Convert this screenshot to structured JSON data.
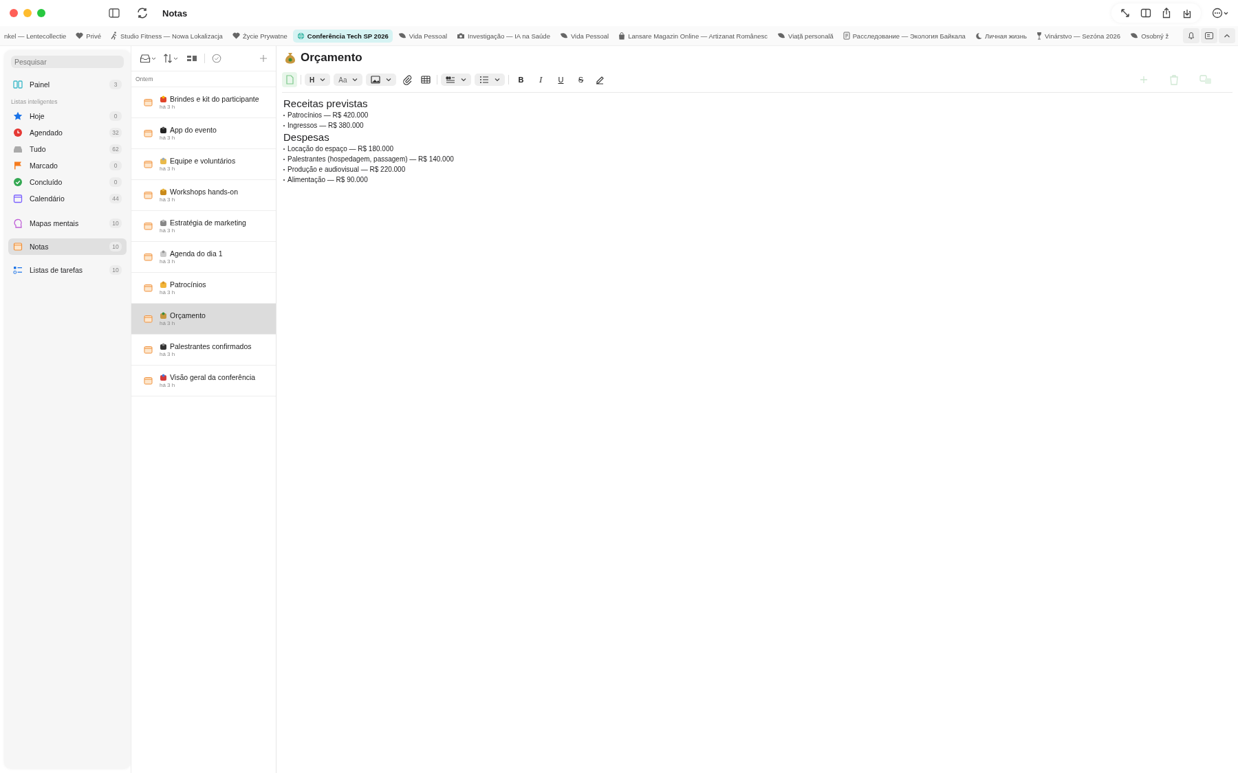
{
  "window": {
    "title": "Notas"
  },
  "tabs": [
    {
      "label": "nkel — Lentecollectie",
      "selected": false
    },
    {
      "label": "Privé",
      "selected": false
    },
    {
      "label": "Studio Fitness — Nowa Lokalizacja",
      "selected": false
    },
    {
      "label": "Życie Prywatne",
      "selected": false
    },
    {
      "label": "Conferência Tech SP 2026",
      "selected": true
    },
    {
      "label": "Vida Pessoal",
      "selected": false
    },
    {
      "label": "Investigação — IA na Saúde",
      "selected": false
    },
    {
      "label": "Vida Pessoal",
      "selected": false
    },
    {
      "label": "Lansare Magazin Online — Artizanat Românesc",
      "selected": false
    },
    {
      "label": "Viață personală",
      "selected": false
    },
    {
      "label": "Расследование — Экология Байкала",
      "selected": false
    },
    {
      "label": "Личная жизнь",
      "selected": false
    },
    {
      "label": "Vinárstvo — Sezóna 2026",
      "selected": false
    },
    {
      "label": "Osobný ž",
      "selected": false
    }
  ],
  "sidebar": {
    "search": {
      "placeholder": "Pesquisar"
    },
    "top": [
      {
        "label": "Painel",
        "count": "3",
        "selected": false
      }
    ],
    "section_title": "Listas inteligentes",
    "smart_lists": [
      {
        "label": "Hoje",
        "count": "0",
        "selected": false
      },
      {
        "label": "Agendado",
        "count": "32",
        "selected": false
      },
      {
        "label": "Tudo",
        "count": "62",
        "selected": false
      },
      {
        "label": "Marcado",
        "count": "0",
        "selected": false
      },
      {
        "label": "Concluído",
        "count": "0",
        "selected": false
      },
      {
        "label": "Calendário",
        "count": "44",
        "selected": false
      }
    ],
    "groups": [
      {
        "label": "Mapas mentais",
        "count": "10",
        "selected": false
      },
      {
        "label": "Notas",
        "count": "10",
        "selected": true
      },
      {
        "label": "Listas de tarefas",
        "count": "10",
        "selected": false
      }
    ]
  },
  "note_list": {
    "section": "Ontem",
    "notes": [
      {
        "title": "Brindes e kit do participante",
        "time": "há 3 h",
        "selected": false
      },
      {
        "title": "App do evento",
        "time": "há 3 h",
        "selected": false
      },
      {
        "title": "Equipe e voluntários",
        "time": "há 3 h",
        "selected": false
      },
      {
        "title": "Workshops hands-on",
        "time": "há 3 h",
        "selected": false
      },
      {
        "title": "Estratégia de marketing",
        "time": "há 3 h",
        "selected": false
      },
      {
        "title": "Agenda do dia 1",
        "time": "há 3 h",
        "selected": false
      },
      {
        "title": "Patrocínios",
        "time": "há 3 h",
        "selected": false
      },
      {
        "title": "Orçamento",
        "time": "há 3 h",
        "selected": true
      },
      {
        "title": "Palestrantes confirmados",
        "time": "há 3 h",
        "selected": false
      },
      {
        "title": "Visão geral da conferência",
        "time": "há 3 h",
        "selected": false
      }
    ]
  },
  "editor": {
    "title": "Orçamento",
    "toolbar": {
      "heading": "H",
      "font": "Aa",
      "bold": "B",
      "italic": "I",
      "underline": "U",
      "strike": "S"
    },
    "blocks": [
      {
        "kind": "heading",
        "text": "Receitas previstas"
      },
      {
        "kind": "bullet",
        "text": "Patrocínios — R$ 420.000"
      },
      {
        "kind": "bullet",
        "text": "Ingressos — R$ 380.000"
      },
      {
        "kind": "heading",
        "text": "Despesas"
      },
      {
        "kind": "bullet",
        "text": "Locação do espaço — R$ 180.000"
      },
      {
        "kind": "bullet",
        "text": "Palestrantes (hospedagem, passagem) — R$ 140.000"
      },
      {
        "kind": "bullet",
        "text": "Produção e audiovisual — R$ 220.000"
      },
      {
        "kind": "bullet",
        "text": "Alimentação — R$ 90.000"
      }
    ]
  }
}
